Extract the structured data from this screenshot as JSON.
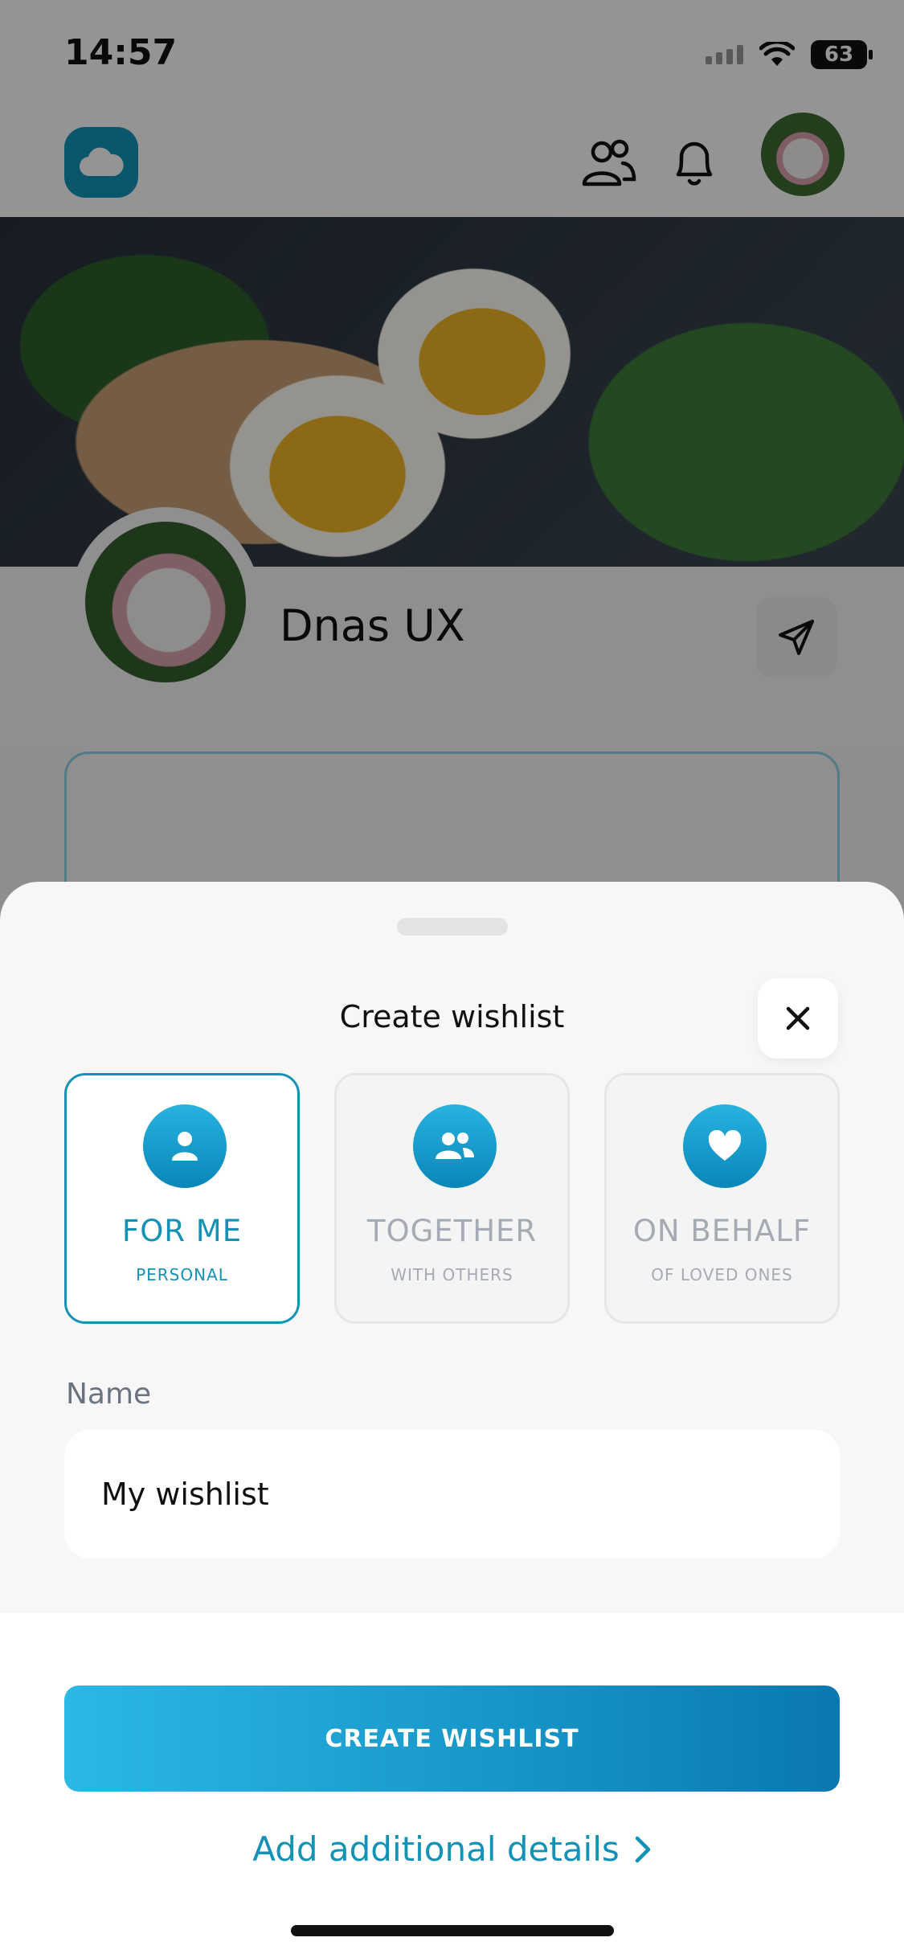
{
  "status_bar": {
    "time": "14:57",
    "battery": "63"
  },
  "profile": {
    "name": "Dnas UX"
  },
  "sheet": {
    "title": "Create wishlist",
    "options": [
      {
        "label": "FOR ME",
        "sublabel": "PERSONAL",
        "icon": "person-icon",
        "selected": true
      },
      {
        "label": "TOGETHER",
        "sublabel": "WITH OTHERS",
        "icon": "people-icon",
        "selected": false
      },
      {
        "label": "ON BEHALF",
        "sublabel": "OF LOVED ONES",
        "icon": "heart-icon",
        "selected": false
      }
    ],
    "name_field": {
      "label": "Name",
      "value": "My wishlist"
    },
    "primary_button": "CREATE WISHLIST",
    "secondary_link": "Add additional details"
  },
  "colors": {
    "accent": "#1492b5",
    "inactive": "#a6abb3",
    "logo": "#1296b8"
  }
}
